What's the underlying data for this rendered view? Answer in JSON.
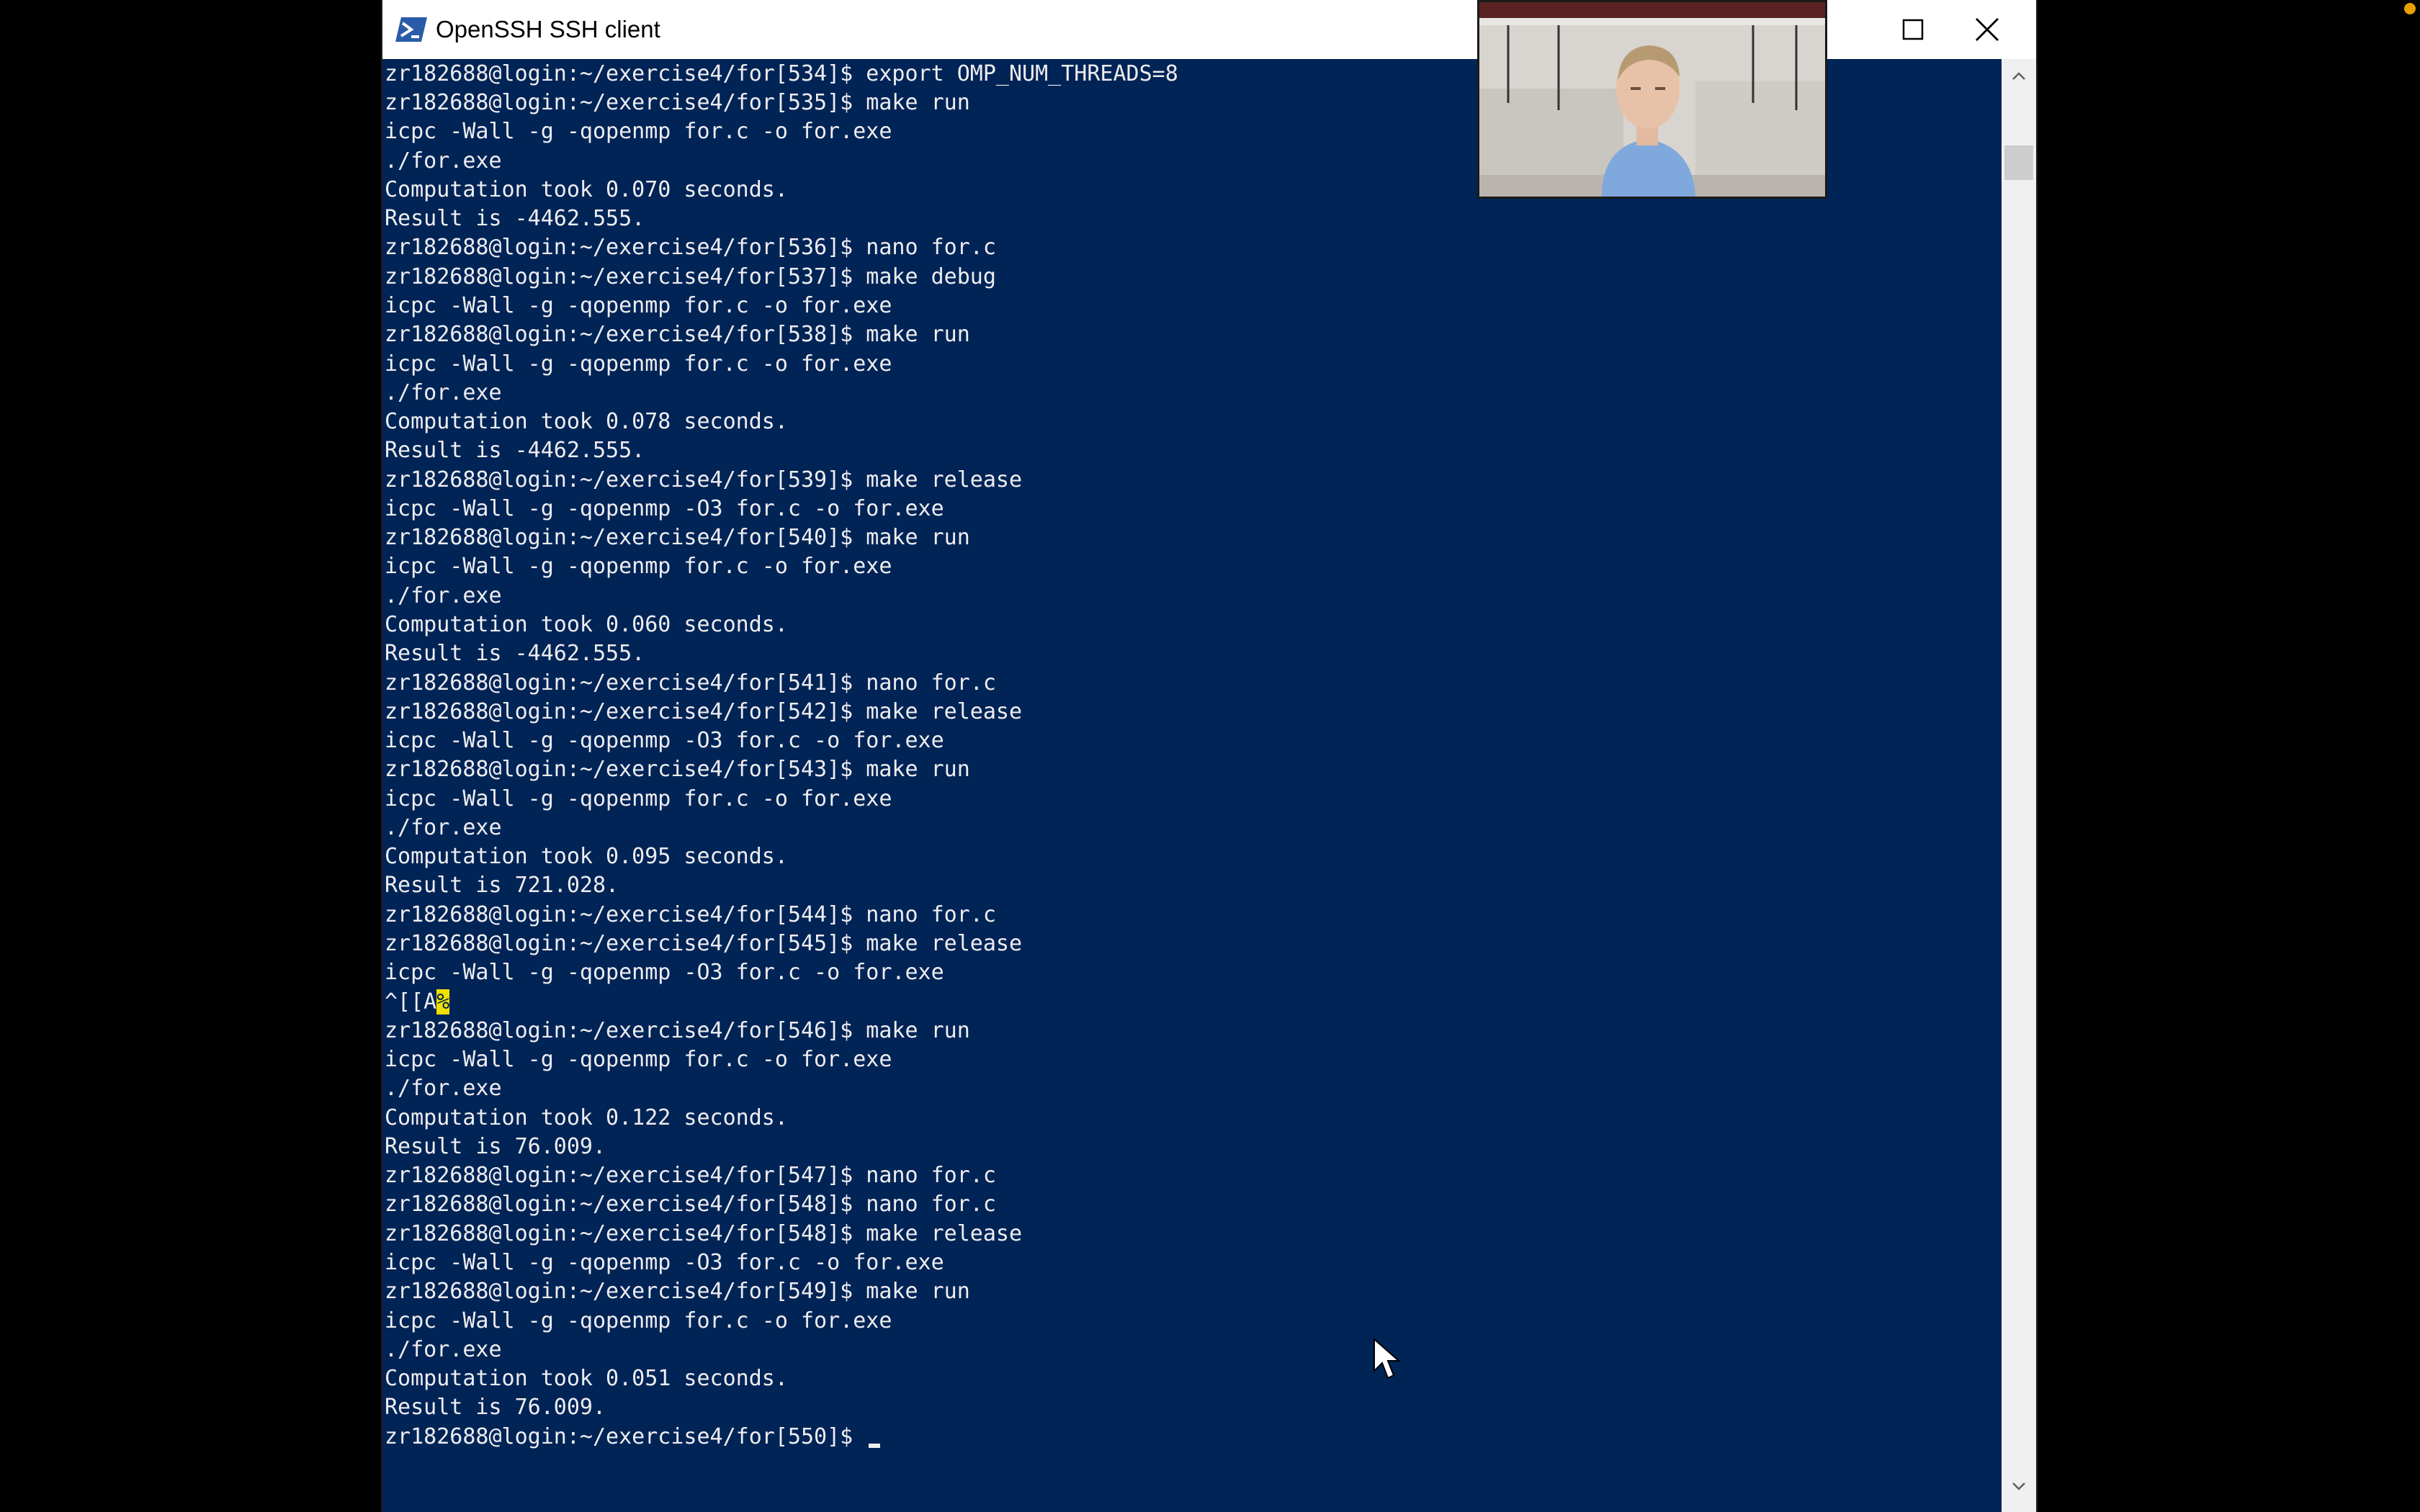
{
  "window": {
    "title": "OpenSSH SSH client",
    "app_icon": "powershell-icon",
    "controls": {
      "maximize": "maximize-icon",
      "close": "close-icon"
    }
  },
  "colors": {
    "terminal_background": "#012456",
    "terminal_text": "#eeedf0",
    "highlight": "#f0e000"
  },
  "terminal": {
    "lines": [
      "zr182688@login:~/exercise4/for[534]$ export OMP_NUM_THREADS=8",
      "zr182688@login:~/exercise4/for[535]$ make run",
      "icpc -Wall -g -qopenmp for.c -o for.exe",
      "./for.exe",
      "Computation took 0.070 seconds.",
      "Result is -4462.555.",
      "zr182688@login:~/exercise4/for[536]$ nano for.c",
      "zr182688@login:~/exercise4/for[537]$ make debug",
      "icpc -Wall -g -qopenmp for.c -o for.exe",
      "zr182688@login:~/exercise4/for[538]$ make run",
      "icpc -Wall -g -qopenmp for.c -o for.exe",
      "./for.exe",
      "Computation took 0.078 seconds.",
      "Result is -4462.555.",
      "zr182688@login:~/exercise4/for[539]$ make release",
      "icpc -Wall -g -qopenmp -O3 for.c -o for.exe",
      "zr182688@login:~/exercise4/for[540]$ make run",
      "icpc -Wall -g -qopenmp for.c -o for.exe",
      "./for.exe",
      "Computation took 0.060 seconds.",
      "Result is -4462.555.",
      "zr182688@login:~/exercise4/for[541]$ nano for.c",
      "zr182688@login:~/exercise4/for[542]$ make release",
      "icpc -Wall -g -qopenmp -O3 for.c -o for.exe",
      "zr182688@login:~/exercise4/for[543]$ make run",
      "icpc -Wall -g -qopenmp for.c -o for.exe",
      "./for.exe",
      "Computation took 0.095 seconds.",
      "Result is 721.028.",
      "zr182688@login:~/exercise4/for[544]$ nano for.c",
      "zr182688@login:~/exercise4/for[545]$ make release",
      "icpc -Wall -g -qopenmp -O3 for.c -o for.exe",
      "^[[A",
      "zr182688@login:~/exercise4/for[546]$ make run",
      "icpc -Wall -g -qopenmp for.c -o for.exe",
      "./for.exe",
      "Computation took 0.122 seconds.",
      "Result is 76.009.",
      "zr182688@login:~/exercise4/for[547]$ nano for.c",
      "zr182688@login:~/exercise4/for[548]$ nano for.c",
      "zr182688@login:~/exercise4/for[548]$ make release",
      "icpc -Wall -g -qopenmp -O3 for.c -o for.exe",
      "zr182688@login:~/exercise4/for[549]$ make run",
      "icpc -Wall -g -qopenmp for.c -o for.exe",
      "./for.exe",
      "Computation took 0.051 seconds.",
      "Result is 76.009."
    ],
    "highlight_char": "%",
    "current_prompt": "zr182688@login:~/exercise4/for[550]$ "
  },
  "overlays": {
    "webcam": "webcam-feed",
    "pointer": "mouse-pointer-icon"
  }
}
